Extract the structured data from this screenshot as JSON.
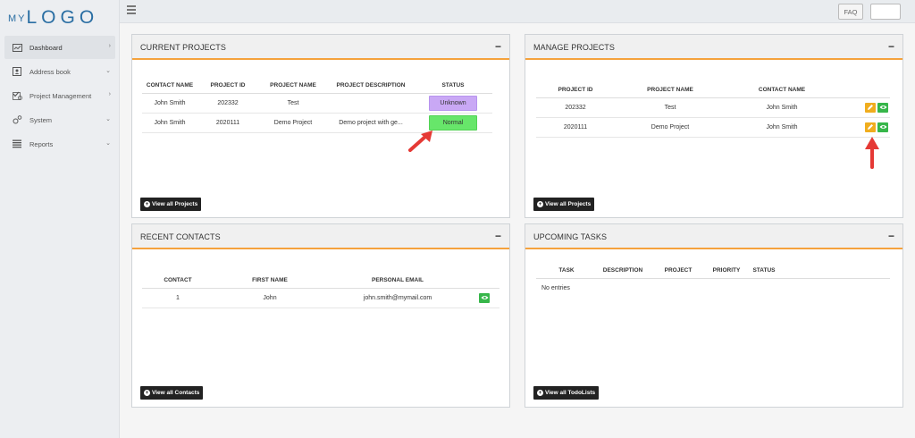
{
  "logo": {
    "my": "MY",
    "main": "LOGO"
  },
  "nav": [
    {
      "label": "Dashboard",
      "icon": "dashboard-icon",
      "chevron": "›",
      "active": true
    },
    {
      "label": "Address book",
      "icon": "address-book-icon",
      "chevron": "⌄",
      "active": false
    },
    {
      "label": "Project Management",
      "icon": "project-management-icon",
      "chevron": "›",
      "active": false
    },
    {
      "label": "System",
      "icon": "gears-icon",
      "chevron": "⌄",
      "active": false
    },
    {
      "label": "Reports",
      "icon": "reports-icon",
      "chevron": "⌄",
      "active": false
    }
  ],
  "topbar": {
    "faq_label": "FAQ"
  },
  "current_projects": {
    "title": "CURRENT PROJECTS",
    "collapse": "−",
    "columns": [
      "CONTACT NAME",
      "PROJECT ID",
      "PROJECT NAME",
      "PROJECT DESCRIPTION",
      "STATUS"
    ],
    "rows": [
      {
        "contact": "John Smith",
        "id": "202332",
        "name": "Test",
        "description": "",
        "status": "Unknown"
      },
      {
        "contact": "John Smith",
        "id": "2020111",
        "name": "Demo Project",
        "description": "Demo project with ge...",
        "status": "Normal"
      }
    ],
    "view_all": "View all Projects"
  },
  "manage_projects": {
    "title": "MANAGE PROJECTS",
    "collapse": "−",
    "columns": [
      "PROJECT ID",
      "PROJECT NAME",
      "CONTACT NAME",
      ""
    ],
    "rows": [
      {
        "id": "202332",
        "name": "Test",
        "contact": "John Smith"
      },
      {
        "id": "2020111",
        "name": "Demo Project",
        "contact": "John Smith"
      }
    ],
    "view_all": "View all Projects"
  },
  "recent_contacts": {
    "title": "RECENT CONTACTS",
    "collapse": "−",
    "columns": [
      "CONTACT",
      "FIRST NAME",
      "PERSONAL EMAIL",
      ""
    ],
    "rows": [
      {
        "contact": "1",
        "first_name": "John",
        "email": "john.smith@mymail.com"
      }
    ],
    "view_all": "View all Contacts"
  },
  "upcoming_tasks": {
    "title": "UPCOMING TASKS",
    "collapse": "−",
    "columns": [
      "TASK",
      "DESCRIPTION",
      "PROJECT",
      "PRIORITY",
      "STATUS"
    ],
    "empty_text": "No entries",
    "view_all": "View all TodoLists"
  },
  "colors": {
    "accent": "#f5a23c",
    "status_unknown": "#c9a8f5",
    "status_normal": "#67e66a",
    "edit_button": "#f0ad1e",
    "view_button": "#37b64a",
    "annotation_arrow": "#e53935"
  }
}
